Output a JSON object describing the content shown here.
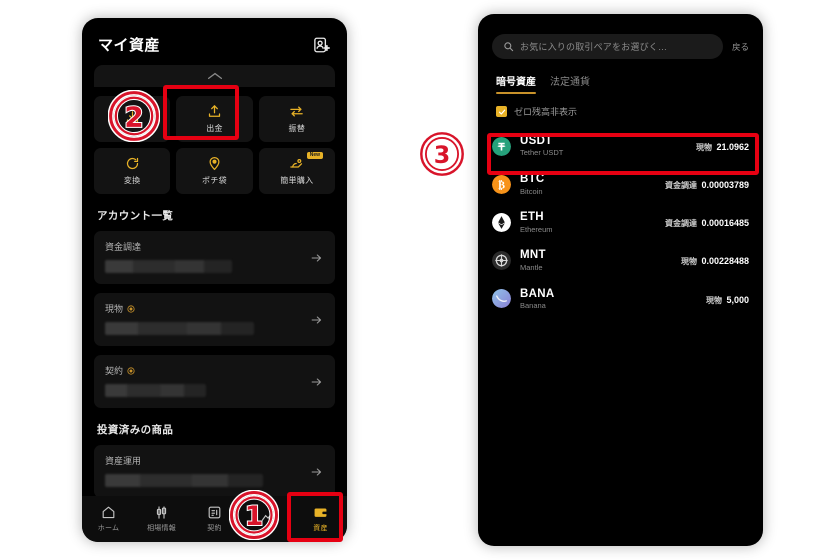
{
  "left_phone": {
    "header": {
      "title": "マイ資産",
      "add_user_icon": "add-user-icon"
    },
    "collapse_icon": "chevron-up-icon",
    "actions": [
      {
        "label": "",
        "icon": "deposit-icon",
        "badge": "",
        "covered": true
      },
      {
        "label": "出金",
        "icon": "withdraw-icon",
        "badge": "",
        "covered": false
      },
      {
        "label": "振替",
        "icon": "transfer-icon",
        "badge": "",
        "covered": false
      },
      {
        "label": "変換",
        "icon": "convert-icon",
        "badge": "",
        "covered": false
      },
      {
        "label": "ポチ袋",
        "icon": "redpacket-icon",
        "badge": "",
        "covered": false
      },
      {
        "label": "簡単購入",
        "icon": "easybuy-icon",
        "badge": "New",
        "covered": false
      }
    ],
    "accounts_section": {
      "title": "アカウント一覧",
      "items": [
        {
          "label": "資金調達",
          "has_badge": false,
          "value": "",
          "arrow": "chevron-right-icon"
        },
        {
          "label": "現物",
          "has_badge": true,
          "value": "",
          "arrow": "chevron-right-icon"
        },
        {
          "label": "契約",
          "has_badge": true,
          "value": "",
          "arrow": "chevron-right-icon"
        }
      ]
    },
    "invested_section": {
      "title": "投資済みの商品",
      "items": [
        {
          "label": "資産運用",
          "value": "",
          "arrow": "chevron-right-icon"
        }
      ]
    },
    "bottom_nav": [
      {
        "label": "ホーム",
        "icon": "home-icon",
        "active": false
      },
      {
        "label": "相場情報",
        "icon": "market-chart-icon",
        "active": false
      },
      {
        "label": "契約",
        "icon": "contract-list-icon",
        "active": false
      },
      {
        "label": "",
        "icon": "trade-icon",
        "active": false
      },
      {
        "label": "資産",
        "icon": "wallet-icon",
        "active": true
      }
    ]
  },
  "right_phone": {
    "search": {
      "placeholder": "お気に入りの取引ペアをお選びく…",
      "icon": "search-icon",
      "back_label": "戻る"
    },
    "tabs": [
      {
        "label": "暗号資産",
        "active": true
      },
      {
        "label": "法定通貨",
        "active": false
      }
    ],
    "zero_balance_filter": {
      "label": "ゼロ残高非表示",
      "checked": true,
      "icon": "check-icon"
    },
    "coins": [
      {
        "symbol": "USDT",
        "name": "Tether USDT",
        "account_type": "現物",
        "amount": "21.0962",
        "color": "#26a17b",
        "glyph": "₮",
        "highlighted": true
      },
      {
        "symbol": "BTC",
        "name": "Bitcoin",
        "account_type": "資金調達",
        "amount": "0.00003789",
        "color": "#f7931a",
        "glyph": "₿",
        "highlighted": false
      },
      {
        "symbol": "ETH",
        "name": "Ethereum",
        "account_type": "資金調達",
        "amount": "0.00016485",
        "color": "#ffffff",
        "glyph": "◆",
        "highlighted": false
      },
      {
        "symbol": "MNT",
        "name": "Mantle",
        "account_type": "現物",
        "amount": "0.00228488",
        "color": "#3f3f3f",
        "glyph": "◈",
        "highlighted": false
      },
      {
        "symbol": "BANA",
        "name": "Banana",
        "account_type": "現物",
        "amount": "5,000",
        "color": "#7b9fe0",
        "glyph": "●",
        "highlighted": false
      }
    ]
  },
  "annotations": {
    "color": "#e60012",
    "markers": [
      {
        "id": "marker-1",
        "label": "①",
        "target": "bottom-nav-assets"
      },
      {
        "id": "marker-2",
        "label": "②",
        "target": "action-deposit-tile"
      },
      {
        "id": "marker-3",
        "label": "③",
        "target": "usdt-coin-row"
      }
    ],
    "highlight_boxes": [
      {
        "id": "highlight-withdraw",
        "target": "action-withdraw-tile"
      },
      {
        "id": "highlight-assets-nav",
        "target": "bottom-nav-assets"
      },
      {
        "id": "highlight-usdt",
        "target": "usdt-coin-row"
      }
    ]
  }
}
